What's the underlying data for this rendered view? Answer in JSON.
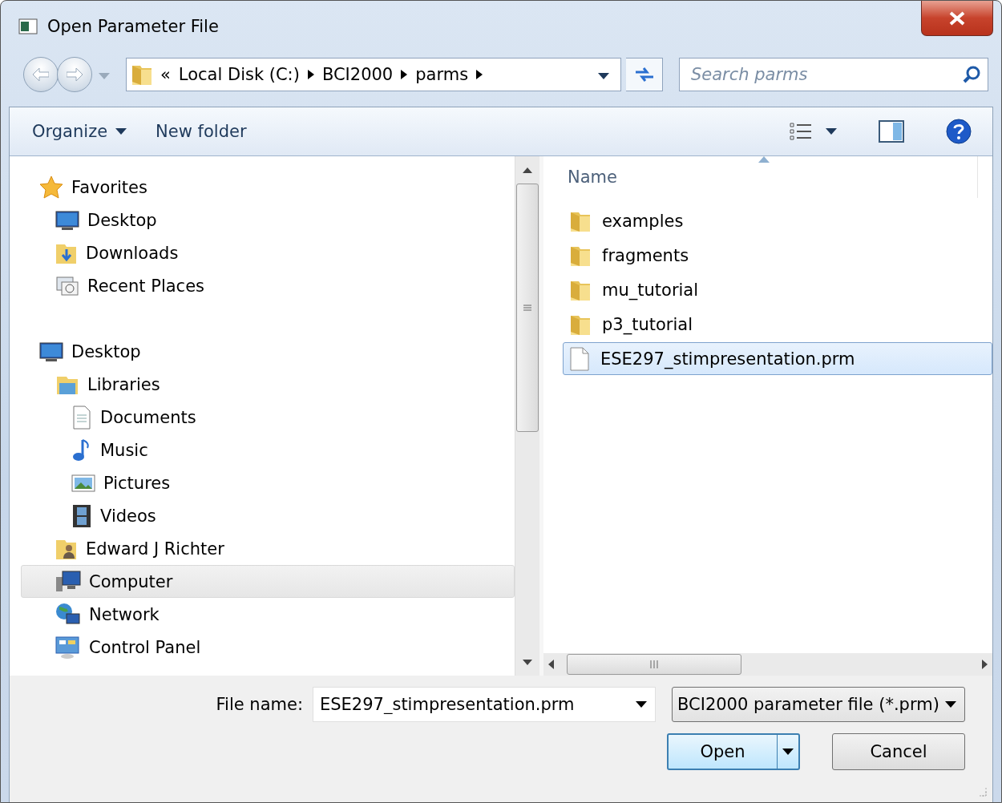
{
  "window": {
    "title": "Open Parameter File"
  },
  "address": {
    "prefix": "«",
    "crumbs": [
      "Local Disk (C:)",
      "BCI2000",
      "parms"
    ]
  },
  "search": {
    "placeholder": "Search parms"
  },
  "toolbar": {
    "organize": "Organize",
    "new_folder": "New folder"
  },
  "sidebar": {
    "groups": [
      {
        "label": "Favorites",
        "selected": false,
        "children": [
          {
            "label": "Desktop",
            "selected": false
          },
          {
            "label": "Downloads",
            "selected": false
          },
          {
            "label": "Recent Places",
            "selected": false
          }
        ]
      },
      {
        "label": "Desktop",
        "selected": false,
        "children": [
          {
            "label": "Libraries",
            "selected": false,
            "children": [
              {
                "label": "Documents",
                "selected": false
              },
              {
                "label": "Music",
                "selected": false
              },
              {
                "label": "Pictures",
                "selected": false
              },
              {
                "label": "Videos",
                "selected": false
              }
            ]
          },
          {
            "label": "Edward J Richter",
            "selected": false
          },
          {
            "label": "Computer",
            "selected": true
          },
          {
            "label": "Network",
            "selected": false
          },
          {
            "label": "Control Panel",
            "selected": false
          }
        ]
      }
    ]
  },
  "file_list": {
    "columns": [
      "Name"
    ],
    "rows": [
      {
        "name": "examples",
        "kind": "folder",
        "selected": false
      },
      {
        "name": "fragments",
        "kind": "folder",
        "selected": false
      },
      {
        "name": "mu_tutorial",
        "kind": "folder",
        "selected": false
      },
      {
        "name": "p3_tutorial",
        "kind": "folder",
        "selected": false
      },
      {
        "name": "ESE297_stimpresentation.prm",
        "kind": "file",
        "selected": true
      }
    ]
  },
  "footer": {
    "file_name_label": "File name:",
    "file_name": "ESE297_stimpresentation.prm",
    "filter": "BCI2000 parameter file (*.prm)",
    "buttons": [
      {
        "label": "Open",
        "kind": "split"
      },
      {
        "label": "Cancel",
        "kind": "plain"
      }
    ]
  }
}
